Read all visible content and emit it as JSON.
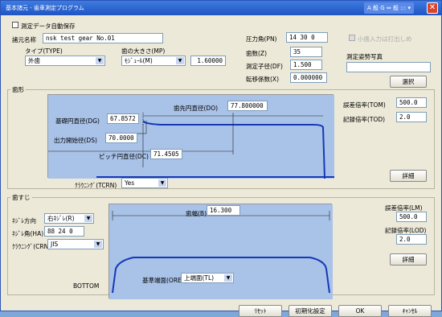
{
  "window": {
    "title": "基本諸元 - 歯車測定プログラム",
    "tools_label": "A 般 G ⇔ 般 ::: ▾",
    "close_label": "✕"
  },
  "top": {
    "measure_check_label": "測定データ自動保存",
    "name_label": "諸元名称",
    "name_value": "nsk test gear No.01",
    "type_label": "タイプ(TYPE)",
    "type_value": "外歯",
    "size_label": "歯の大きさ(MP)",
    "size_unit_value": "ﾓｼﾞｭｰﾙ(M)",
    "size_value": "1.60000",
    "pressure_label": "圧力角(PN)",
    "pressure_value": "14 30  0",
    "teeth_label": "歯数(Z)",
    "teeth_value": "35",
    "dial_label": "測定子径(DF)",
    "dial_value": "1.500",
    "shift_label": "転移係数(X)",
    "shift_value": "0.000000",
    "disabled_check_label": "小歯入力は打出しめ",
    "photo_label": "測定姿勢写真",
    "photo_value": "",
    "select_button": "選択"
  },
  "profile": {
    "group_label": "歯形",
    "tip_dia_label": "歯先円直径(DO)",
    "tip_dia_value": "77.800000",
    "base_dia_label": "基礎円直径(DG)",
    "base_dia_value": "67.8572",
    "start_dia_label": "出力開始径(DS)",
    "start_dia_value": "70.0000",
    "pitch_dia_label": "ピッチ円直径(DC)",
    "pitch_dia_value": "71.4505",
    "crowning_label": "ｸﾗｳﾆﾝｸﾞ(TCRN)",
    "crowning_value": "Yes",
    "tol_label": "誤差倍率(TOM)",
    "tol_value": "500.0",
    "rec_label": "記録倍率(TOD)",
    "rec_value": "2.0",
    "detail_button": "詳細"
  },
  "lead": {
    "group_label": "歯すじ",
    "helix_dir_label": "ﾈｼﾞﾚ方向",
    "helix_dir_value": "右ﾈｼﾞﾚ(R)",
    "helix_angle_label": "ﾈｼﾞﾚ角(HA)",
    "helix_angle_value": "88 24  0",
    "crown_label": "ｸﾗｳﾆﾝｸﾞ(CRN)",
    "crown_value": "JIS",
    "face_width_label": "歯幅(B)",
    "face_width_value": "16.300",
    "ref_label": "基準端面(OREF)",
    "ref_value": "上端面(TL)",
    "bottom_label": "BOTTOM",
    "tol_label": "誤差倍率(LM)",
    "tol_value": "500.0",
    "rec_label": "記録倍率(LOD)",
    "rec_value": "2.0",
    "detail_button": "詳細"
  },
  "footer": {
    "b1": "ﾘｾｯﾄ",
    "b2": "初期化設定",
    "b3": "OK",
    "b4": "ｷｬﾝｾﾙ"
  }
}
